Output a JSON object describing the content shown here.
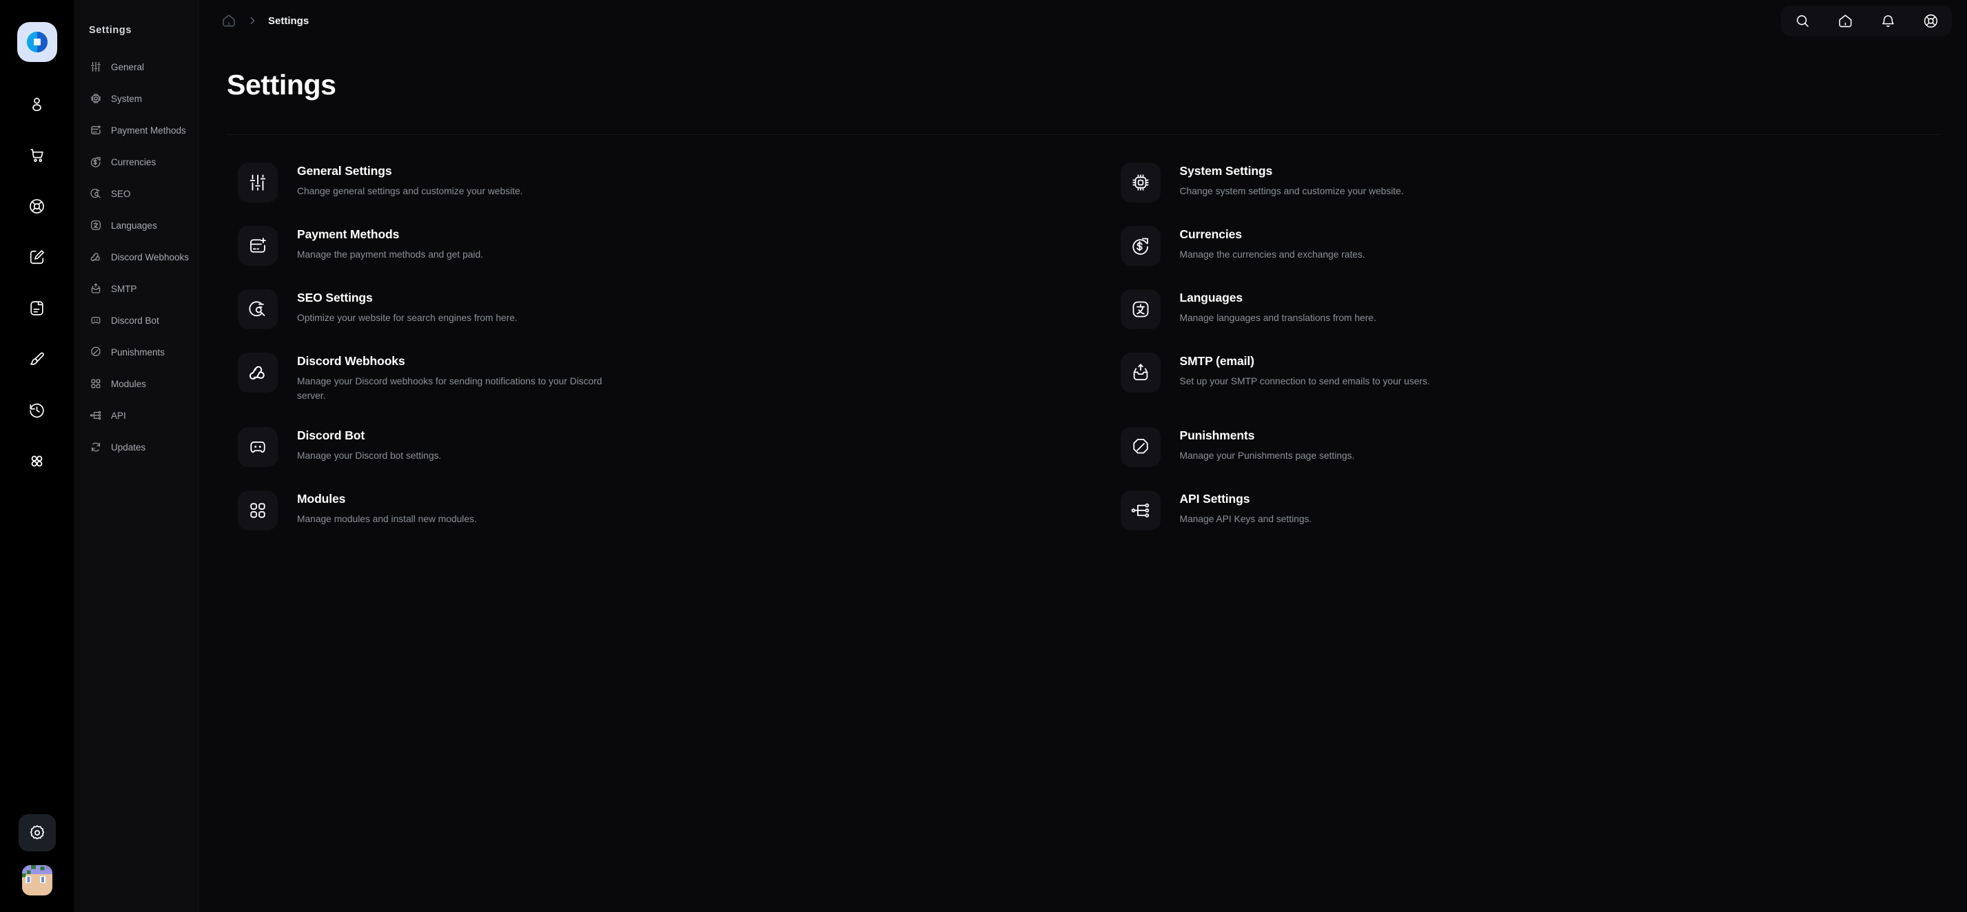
{
  "rail": {
    "logo_name": "app-logo",
    "items": [
      {
        "name": "user-icon",
        "label": "Users"
      },
      {
        "name": "shopping-cart-icon",
        "label": "Store"
      },
      {
        "name": "lifebuoy-icon",
        "label": "Support"
      },
      {
        "name": "edit-pencil-icon",
        "label": "Editor"
      },
      {
        "name": "document-icon",
        "label": "Pages"
      },
      {
        "name": "paintbrush-icon",
        "label": "Appearance"
      },
      {
        "name": "history-clock-icon",
        "label": "History"
      },
      {
        "name": "grid-apps-icon",
        "label": "Apps"
      }
    ],
    "bottom": [
      {
        "name": "gear-icon",
        "label": "Settings",
        "active": true
      },
      {
        "name": "avatar",
        "label": "Profile"
      }
    ]
  },
  "sidebar": {
    "title": "Settings",
    "items": [
      {
        "label": "General",
        "icon": "sliders-icon"
      },
      {
        "label": "System",
        "icon": "cpu-chip-icon"
      },
      {
        "label": "Payment Methods",
        "icon": "card-plus-icon"
      },
      {
        "label": "Currencies",
        "icon": "dollar-trend-icon"
      },
      {
        "label": "SEO",
        "icon": "seo-search-icon"
      },
      {
        "label": "Languages",
        "icon": "language-icon"
      },
      {
        "label": "Discord Webhooks",
        "icon": "webhook-icon"
      },
      {
        "label": "SMTP",
        "icon": "outbox-icon"
      },
      {
        "label": "Discord Bot",
        "icon": "discord-bot-icon"
      },
      {
        "label": "Punishments",
        "icon": "ban-icon"
      },
      {
        "label": "Modules",
        "icon": "modules-grid-icon"
      },
      {
        "label": "API",
        "icon": "api-nodes-icon"
      },
      {
        "label": "Updates",
        "icon": "refresh-icon"
      }
    ]
  },
  "header": {
    "breadcrumb": {
      "home_icon": "home-icon",
      "separator_icon": "chevron-right-icon",
      "current": "Settings"
    },
    "actions": [
      {
        "name": "search-icon",
        "label": "Search"
      },
      {
        "name": "home-icon",
        "label": "Home"
      },
      {
        "name": "bell-icon",
        "label": "Notifications"
      },
      {
        "name": "lifebuoy-icon",
        "label": "Help"
      }
    ]
  },
  "page": {
    "title": "Settings"
  },
  "cards": [
    {
      "title": "General Settings",
      "desc": "Change general settings and customize your website.",
      "icon": "sliders-icon"
    },
    {
      "title": "System Settings",
      "desc": "Change system settings and customize your website.",
      "icon": "cpu-chip-icon"
    },
    {
      "title": "Payment Methods",
      "desc": "Manage the payment methods and get paid.",
      "icon": "card-plus-icon"
    },
    {
      "title": "Currencies",
      "desc": "Manage the currencies and exchange rates.",
      "icon": "dollar-trend-icon"
    },
    {
      "title": "SEO Settings",
      "desc": "Optimize your website for search engines from here.",
      "icon": "seo-search-icon"
    },
    {
      "title": "Languages",
      "desc": "Manage languages and translations from here.",
      "icon": "language-icon"
    },
    {
      "title": "Discord Webhooks",
      "desc": "Manage your Discord webhooks for sending notifications to your Discord server.",
      "icon": "webhook-icon"
    },
    {
      "title": "SMTP (email)",
      "desc": "Set up your SMTP connection to send emails to your users.",
      "icon": "outbox-icon"
    },
    {
      "title": "Discord Bot",
      "desc": "Manage your Discord bot settings.",
      "icon": "discord-bot-icon"
    },
    {
      "title": "Punishments",
      "desc": "Manage your Punishments page settings.",
      "icon": "ban-icon"
    },
    {
      "title": "Modules",
      "desc": "Manage modules and install new modules.",
      "icon": "modules-grid-icon"
    },
    {
      "title": "API Settings",
      "desc": "Manage API Keys and settings.",
      "icon": "api-nodes-icon"
    }
  ],
  "colors": {
    "background": "#09090b",
    "rail": "#000000",
    "sidebar": "#0d0d0f",
    "card_icon_bg": "#121217",
    "text_primary": "#ffffff",
    "text_muted": "#8b9097",
    "accent_logo": "#1173d4"
  }
}
